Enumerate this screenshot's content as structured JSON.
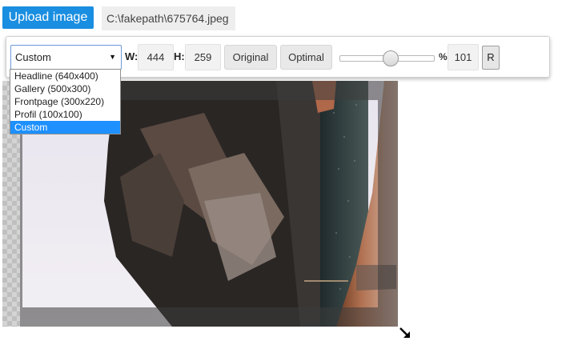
{
  "upload": {
    "label": "Upload image"
  },
  "file": {
    "path": "C:\\fakepath\\675764.jpeg"
  },
  "toolbar": {
    "preset_selected": "Custom",
    "width_label": "W:",
    "width_value": "444",
    "height_label": "H:",
    "height_value": "259",
    "original_label": "Original",
    "optimal_label": "Optimal",
    "zoom_percent_label": "%",
    "zoom_value": "101",
    "zoom_slider_fraction": 0.5,
    "reset_label": "R"
  },
  "dropdown": {
    "options": [
      "Headline (640x400)",
      "Gallery (500x300)",
      "Frontpage (300x220)",
      "Profil (100x100)",
      "Custom"
    ],
    "selected_index": 4
  },
  "colors": {
    "accent": "#1a8ee0",
    "selection": "#1e90ff"
  },
  "icons": {
    "resize": "resize-handle-icon",
    "dropdown_arrow": "chevron-down-icon"
  }
}
